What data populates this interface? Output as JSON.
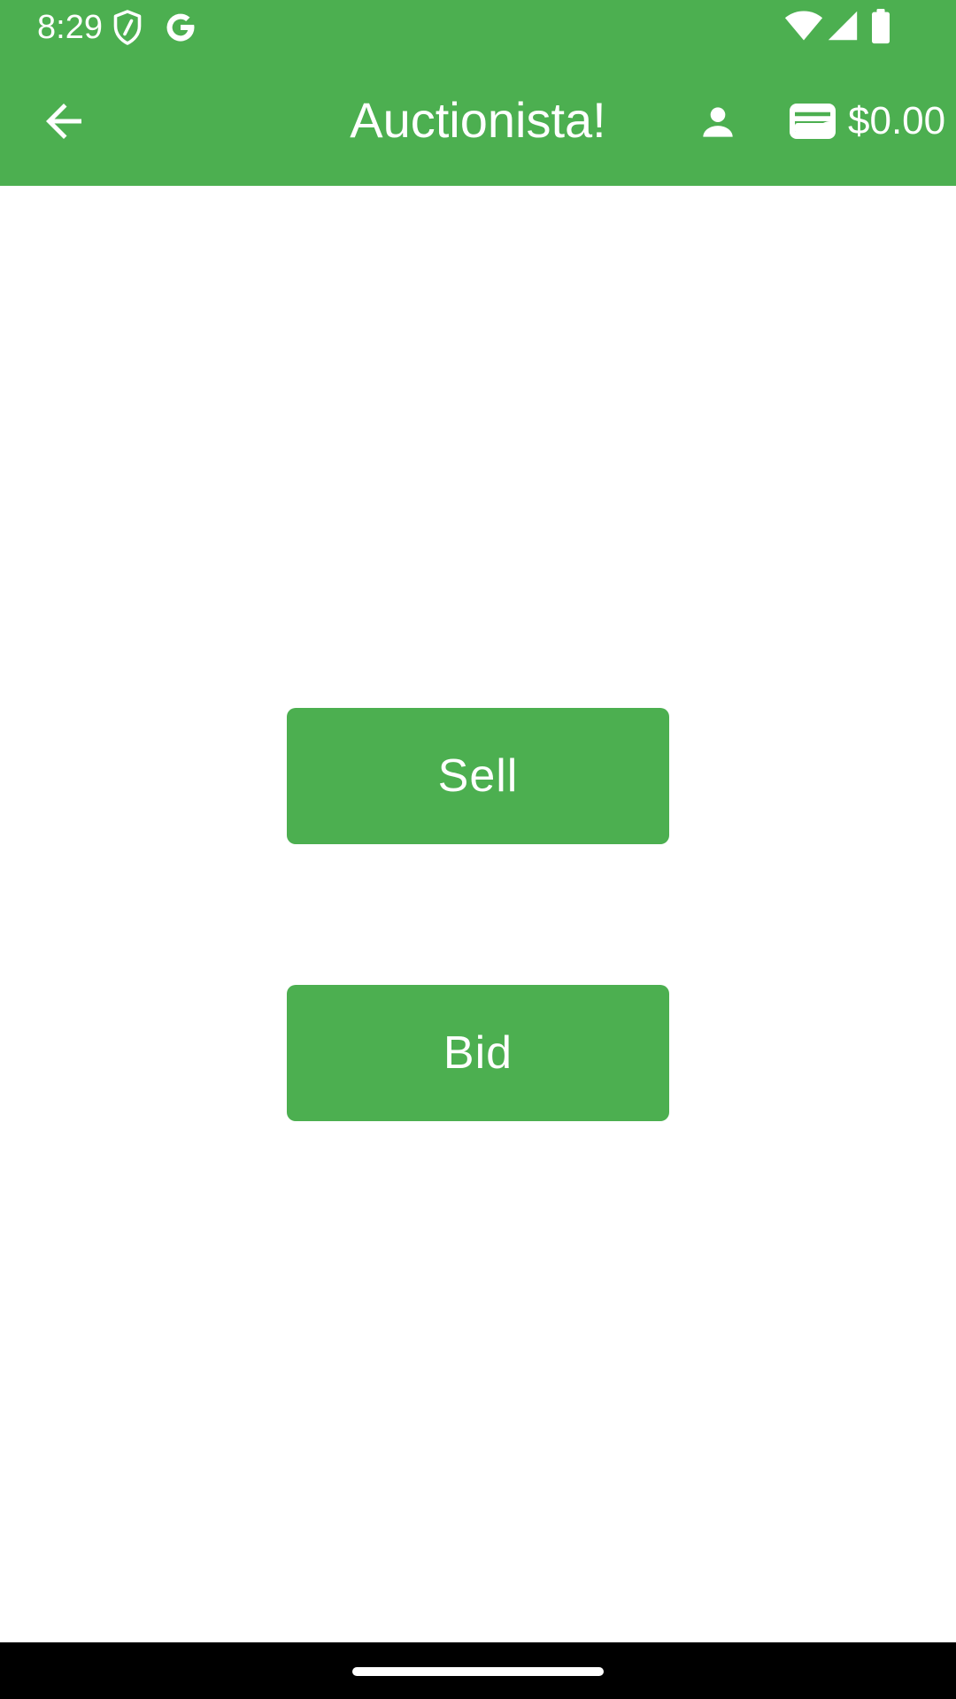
{
  "status_bar": {
    "time": "8:29",
    "icons": [
      "shield-icon",
      "google-g-icon",
      "wifi-icon",
      "cellular-signal-icon",
      "battery-icon"
    ]
  },
  "app_bar": {
    "back_icon": "arrow-back-icon",
    "title": "Auctionista!",
    "profile_icon": "person-icon",
    "wallet_icon": "wallet-icon",
    "balance": "$0.00"
  },
  "main": {
    "sell_label": "Sell",
    "bid_label": "Bid"
  },
  "colors": {
    "primary": "#4caf50",
    "on_primary": "#ffffff",
    "background": "#ffffff",
    "nav_bar": "#000000"
  }
}
